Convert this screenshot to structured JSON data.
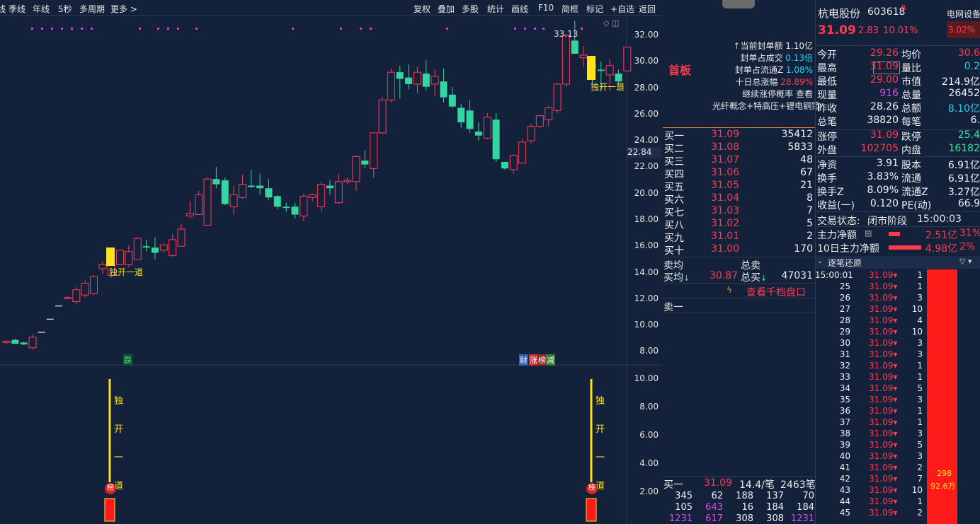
{
  "toolbar": {
    "left": [
      "季线",
      "年线",
      "5秒",
      "多周期",
      "更多 >"
    ],
    "right": [
      "复权",
      "叠加",
      "多股",
      "统计",
      "画线",
      "F10",
      "简框",
      "标记",
      "+自选",
      "返回"
    ]
  },
  "axis": {
    "price_ticks": [
      "32.00",
      "30.00",
      "28.00",
      "26.00",
      "24.00",
      "22.00",
      "20.00",
      "18.00",
      "16.00",
      "14.00",
      "12.00",
      "10.00",
      "8.00"
    ],
    "current": "22.84",
    "sub_ticks": [
      "10.00",
      "8.00",
      "6.00",
      "4.00",
      "2.00"
    ]
  },
  "chart": {
    "high_label": "33.13",
    "ann1": "独开一道",
    "ann2": "独开一道",
    "markers": {
      "die": "跌",
      "cai": "财",
      "zhang": "涨",
      "bang": "榜",
      "jian": "减"
    },
    "sub_text": [
      "独",
      "开",
      "一",
      "道"
    ],
    "bang": "榜"
  },
  "chart_data": {
    "type": "candlestick",
    "ylim": [
      7,
      33.5
    ],
    "candles": [
      [
        8.7,
        8.85,
        8.6,
        8.8
      ],
      [
        8.9,
        9.0,
        8.7,
        8.6
      ],
      [
        8.7,
        8.75,
        8.5,
        8.55
      ],
      [
        8.3,
        9.3,
        8.2,
        9.1
      ],
      [
        9.5,
        9.5,
        9.5,
        9.5
      ],
      [
        10.5,
        10.5,
        10.5,
        10.5
      ],
      [
        11.5,
        11.5,
        11.5,
        11.5
      ],
      [
        12.1,
        12.2,
        12.0,
        12.1
      ],
      [
        11.8,
        12.9,
        11.6,
        12.7
      ],
      [
        12.3,
        13.4,
        12.1,
        13.2
      ],
      [
        12.4,
        13.8,
        12.3,
        13.7
      ],
      [
        14.3,
        14.9,
        13.9,
        14.6
      ],
      [
        13.8,
        14.9,
        13.6,
        14.6
      ],
      [
        14.6,
        15.7,
        14.6,
        15.7
      ],
      [
        14.6,
        16.1,
        14.4,
        15.6
      ],
      [
        15.0,
        16.7,
        15.0,
        16.6
      ],
      [
        16.0,
        16.5,
        15.6,
        15.9
      ],
      [
        15.9,
        16.7,
        15.0,
        15.5
      ],
      [
        15.7,
        16.2,
        15.5,
        16.1
      ],
      [
        15.3,
        16.9,
        15.2,
        16.5
      ],
      [
        16.0,
        17.7,
        16.0,
        17.3
      ],
      [
        18.3,
        19.4,
        18.1,
        18.5
      ],
      [
        18.4,
        20.2,
        18.4,
        19.9
      ],
      [
        17.6,
        21.2,
        17.6,
        21.1
      ],
      [
        21.1,
        22.0,
        20.4,
        20.7
      ],
      [
        21.0,
        21.2,
        19.1,
        19.2
      ],
      [
        19.0,
        20.6,
        18.4,
        19.9
      ],
      [
        19.7,
        21.4,
        19.6,
        20.7
      ],
      [
        20.6,
        21.8,
        20.4,
        20.5
      ],
      [
        20.6,
        21.5,
        19.9,
        20.4
      ],
      [
        20.4,
        21.1,
        19.5,
        19.7
      ],
      [
        19.8,
        19.9,
        18.8,
        19.0
      ],
      [
        19.0,
        19.3,
        18.6,
        18.9
      ],
      [
        19.0,
        19.3,
        18.1,
        18.4
      ],
      [
        18.3,
        20.0,
        17.9,
        19.8
      ],
      [
        19.7,
        20.0,
        19.4,
        19.9
      ],
      [
        19.0,
        20.9,
        18.6,
        20.7
      ],
      [
        20.6,
        21.0,
        19.9,
        20.4
      ],
      [
        19.3,
        21.5,
        19.2,
        20.9
      ],
      [
        20.9,
        21.2,
        20.7,
        21.0
      ],
      [
        20.9,
        22.9,
        20.2,
        22.8
      ],
      [
        22.5,
        23.3,
        21.9,
        22.2
      ],
      [
        21.9,
        24.6,
        21.2,
        24.6
      ],
      [
        24.6,
        27.3,
        24.5,
        27.1
      ],
      [
        27.1,
        29.5,
        26.9,
        29.2
      ],
      [
        29.2,
        29.7,
        27.2,
        28.7
      ],
      [
        28.8,
        29.8,
        27.9,
        28.3
      ],
      [
        28.3,
        29.6,
        27.6,
        29.2
      ],
      [
        29.1,
        30.1,
        27.8,
        28.1
      ],
      [
        28.3,
        29.4,
        27.4,
        28.9
      ],
      [
        28.5,
        29.5,
        26.9,
        27.3
      ],
      [
        27.5,
        28.1,
        26.5,
        26.6
      ],
      [
        26.5,
        26.8,
        25.0,
        25.4
      ],
      [
        26.3,
        27.1,
        24.6,
        24.9
      ],
      [
        24.7,
        25.4,
        24.0,
        24.4
      ],
      [
        24.2,
        26.1,
        24.1,
        25.8
      ],
      [
        25.6,
        26.1,
        22.4,
        22.6
      ],
      [
        22.4,
        22.4,
        21.8,
        21.9
      ],
      [
        21.8,
        23.0,
        21.5,
        22.9
      ],
      [
        22.3,
        24.1,
        22.3,
        23.9
      ],
      [
        24.0,
        25.3,
        23.8,
        25.1
      ],
      [
        25.1,
        26.0,
        25.0,
        25.9
      ],
      [
        25.6,
        26.6,
        25.1,
        26.5
      ],
      [
        26.3,
        28.4,
        26.1,
        28.3
      ],
      [
        28.3,
        32.1,
        28.1,
        32.0
      ],
      [
        31.6,
        33.1,
        30.6,
        30.6
      ],
      [
        30.3,
        31.2,
        29.6,
        30.5
      ],
      [
        29.8,
        30.4,
        28.4,
        29.5
      ],
      [
        29.4,
        30.0,
        27.8,
        29.3
      ],
      [
        29.0,
        30.2,
        27.8,
        29.7
      ],
      [
        29.1,
        29.4,
        28.1,
        28.5
      ],
      [
        29.3,
        31.1,
        29.3,
        31.1
      ]
    ]
  },
  "mid": {
    "board": "首板",
    "info": [
      "当前封单额 1.10亿",
      "封单占成交 0.13倍",
      "封单占流通Z 1.08%",
      "十日总涨幅 28.89%",
      "继续涨停概率 查看",
      "光纤概念+特高压+锂电铜箔"
    ],
    "bids": [
      [
        "买一",
        "31.09",
        "35412"
      ],
      [
        "买二",
        "31.08",
        "5833"
      ],
      [
        "买三",
        "31.07",
        "48"
      ],
      [
        "买四",
        "31.06",
        "67"
      ],
      [
        "买五",
        "31.05",
        "21"
      ],
      [
        "买六",
        "31.04",
        "8"
      ],
      [
        "买七",
        "31.03",
        "7"
      ],
      [
        "买八",
        "31.02",
        "5"
      ],
      [
        "买九",
        "31.01",
        "2"
      ],
      [
        "买十",
        "31.00",
        "170"
      ]
    ],
    "avg": {
      "sell_avg": "卖均",
      "total_sell": "总卖",
      "buy_avg": "买均",
      "buy_avg_val": "30.87",
      "total_buy": "总买",
      "total_buy_val": "47031"
    },
    "thousand": "查看千档盘口",
    "sell1": "卖一",
    "buy1": {
      "label": "买一",
      "price": "31.09",
      "per": "14.4/笔",
      "count": "2463笔"
    },
    "grid": [
      [
        "345",
        "62",
        "188",
        "137",
        "70"
      ],
      [
        "105",
        "643",
        "16",
        "184",
        "184"
      ],
      [
        "1231",
        "617",
        "308",
        "308",
        "1231"
      ]
    ]
  },
  "right": {
    "name": "杭电股份",
    "code": "603618",
    "r": "R",
    "price": "31.09",
    "chg": "2.83",
    "pct": "10.01%",
    "sector": "电网设备",
    "sector_pct": "3.02%",
    "quote": [
      [
        "今开",
        "29.26",
        "均价",
        "30.6"
      ],
      [
        "最高",
        "31.09",
        "量比",
        "0.2"
      ],
      [
        "最低",
        "29.00",
        "市值",
        "214.9亿"
      ],
      [
        "现量",
        "916",
        "总量",
        "26452"
      ],
      [
        "昨收",
        "28.26",
        "总额",
        "8.10亿"
      ],
      [
        "总笔",
        "38820",
        "每笔",
        "6."
      ],
      [
        "涨停",
        "31.09",
        "跌停",
        "25.4"
      ],
      [
        "外盘",
        "102705",
        "内盘",
        "16182"
      ],
      [
        "净资",
        "3.91",
        "股本",
        "6.91亿"
      ],
      [
        "换手",
        "3.83%",
        "流通",
        "6.91亿"
      ],
      [
        "换手Z",
        "8.09%",
        "流通Z",
        "3.27亿"
      ],
      [
        "收益(一)",
        "0.120",
        "PE(动)",
        "66.9"
      ]
    ],
    "status_label": "交易状态:",
    "status": "闭市阶段",
    "time": "15:00:03",
    "main_net": "主力净额",
    "main_net_val": "2.51亿",
    "main_net_pct": "31%",
    "ten_net": "10日主力净额",
    "ten_net_val": "4.98亿",
    "ten_net_pct": "2%",
    "ticks_title": "逐笔还原",
    "first_time": "15:00:01",
    "tick_rows": [
      [
        "15:00:01",
        "31.09",
        "1"
      ],
      [
        "25",
        "31.09",
        "1"
      ],
      [
        "26",
        "31.09",
        "3"
      ],
      [
        "27",
        "31.09",
        "10"
      ],
      [
        "28",
        "31.09",
        "4"
      ],
      [
        "29",
        "31.09",
        "10"
      ],
      [
        "30",
        "31.09",
        "3"
      ],
      [
        "31",
        "31.09",
        "3"
      ],
      [
        "32",
        "31.09",
        "1"
      ],
      [
        "33",
        "31.09",
        "1"
      ],
      [
        "34",
        "31.09",
        "5"
      ],
      [
        "35",
        "31.09",
        "3"
      ],
      [
        "36",
        "31.09",
        "1"
      ],
      [
        "37",
        "31.09",
        "1"
      ],
      [
        "38",
        "31.09",
        "3"
      ],
      [
        "39",
        "31.09",
        "5"
      ],
      [
        "40",
        "31.09",
        "3"
      ],
      [
        "41",
        "31.09",
        "2"
      ],
      [
        "42",
        "31.09",
        "7"
      ],
      [
        "43",
        "31.09",
        "10"
      ],
      [
        "44",
        "31.09",
        "1"
      ],
      [
        "45",
        "31.09",
        "2"
      ]
    ],
    "big_n": "298",
    "big_amt": "92.6万"
  }
}
